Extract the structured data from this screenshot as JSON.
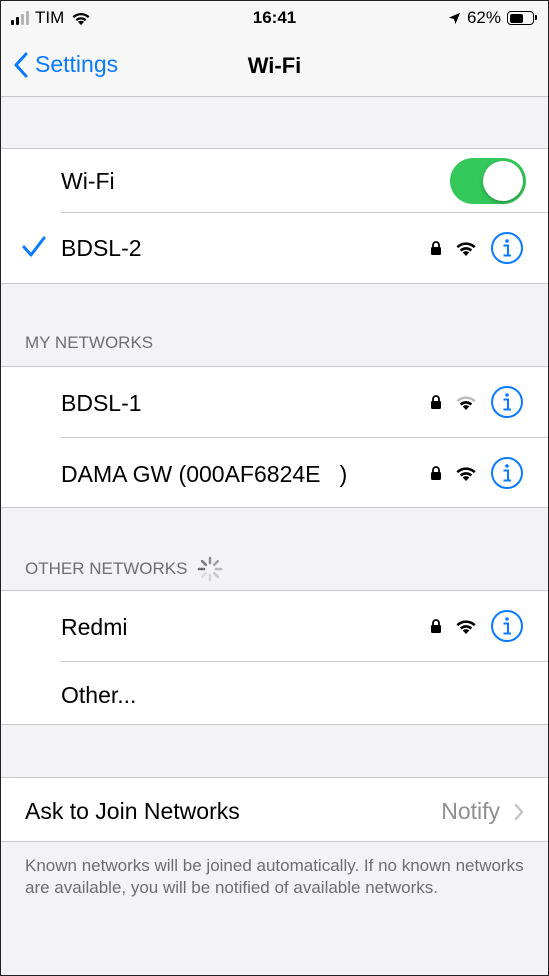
{
  "status_bar": {
    "carrier": "TIM",
    "time": "16:41",
    "battery_percent": "62%",
    "battery_level": 0.62,
    "icons": [
      "signal-icon",
      "wifi-icon",
      "location-arrow-icon",
      "battery-icon"
    ]
  },
  "nav": {
    "back_label": "Settings",
    "title": "Wi-Fi"
  },
  "wifi_toggle": {
    "label": "Wi-Fi",
    "on": true
  },
  "connected_network": {
    "name": "BDSL-2",
    "secured": true
  },
  "my_networks": {
    "header": "MY NETWORKS",
    "items": [
      {
        "name": "BDSL-1",
        "secured": true
      },
      {
        "name": "DAMA GW (000AF6824E",
        "name_suffix": ")",
        "secured": true
      }
    ]
  },
  "other_networks": {
    "header": "OTHER NETWORKS",
    "items": [
      {
        "name": "Redmi",
        "secured": true
      },
      {
        "name": "Other..."
      }
    ]
  },
  "ask_to_join": {
    "label": "Ask to Join Networks",
    "value": "Notify"
  },
  "footer_note": "Known networks will be joined automatically. If no known networks are available, you will be notified of available networks.",
  "colors": {
    "accent": "#0a7aff",
    "toggle_on": "#34c759",
    "background": "#f2f2f7",
    "secondary_text": "#6d6d72"
  }
}
